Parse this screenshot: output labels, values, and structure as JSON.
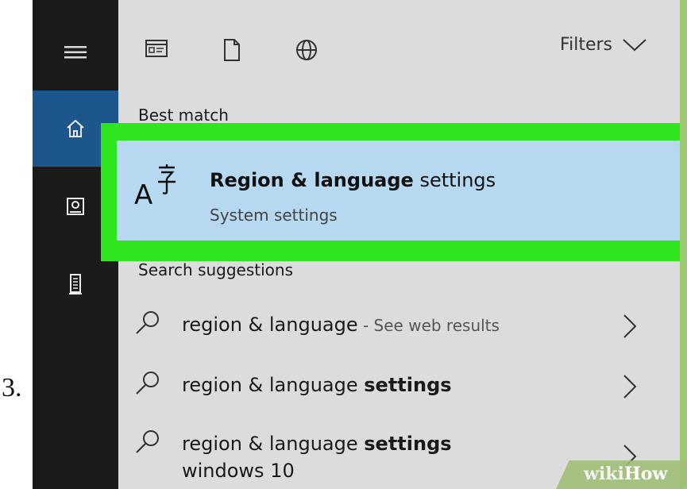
{
  "step": {
    "label": "3."
  },
  "sidebar": {
    "items": [
      {
        "icon": "hamburger-menu-icon"
      },
      {
        "icon": "home-icon",
        "active": true
      },
      {
        "icon": "photo-icon"
      },
      {
        "icon": "tower-icon"
      }
    ]
  },
  "toolbar": {
    "icons": [
      "apps-icon",
      "document-icon",
      "web-globe-icon"
    ],
    "filters_label": "Filters"
  },
  "best_match": {
    "heading": "Best match",
    "title_bold": "Region & language",
    "title_rest": " settings",
    "subtitle": "System settings"
  },
  "suggestions": {
    "heading": "Search suggestions",
    "items": [
      {
        "main": "region & language",
        "bold": "",
        "soft": " - See web results"
      },
      {
        "main": "region & language ",
        "bold": "settings",
        "soft": ""
      },
      {
        "main": "region & language ",
        "bold": "settings",
        "second": "windows 10"
      }
    ]
  },
  "watermark": {
    "wiki": "wiki",
    "how": "How"
  },
  "colors": {
    "sidebar_bg": "#1b1b1b",
    "sidebar_active": "#1d568d",
    "panel_bg": "#dcdcdc",
    "highlight_border": "#2fe51d",
    "best_match_bg": "#b7d8f1"
  }
}
